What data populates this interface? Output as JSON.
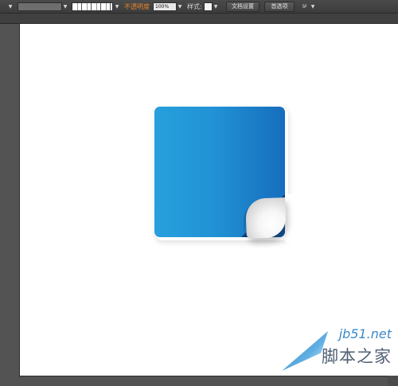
{
  "control_bar": {
    "opacity_label": "不透明度",
    "opacity_value": "100%",
    "style_label": "样式:",
    "document_setup_button": "文档设置",
    "preferences_button": "首选项"
  },
  "watermark": {
    "domain": "jb51.net",
    "name": "脚本之家"
  },
  "colors": {
    "note_blue_light": "#27a0dd",
    "note_blue_dark": "#166ebd",
    "opacity_label_orange": "#e8862a",
    "workspace_gray": "#535353"
  }
}
